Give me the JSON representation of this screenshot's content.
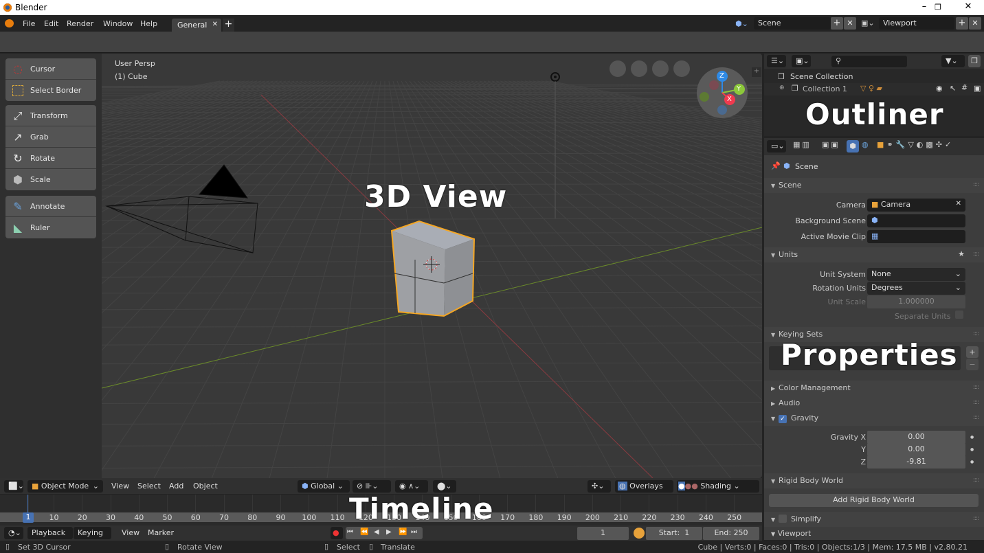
{
  "window": {
    "title": "Blender",
    "controls": [
      "–",
      "❐",
      "✕"
    ]
  },
  "menubar": {
    "items": [
      "File",
      "Edit",
      "Render",
      "Window",
      "Help"
    ],
    "workspace_tab": "General",
    "close": "✕",
    "add": "+",
    "scene": {
      "value": "Scene",
      "add": "+",
      "remove": "✕"
    },
    "view_layer": {
      "value": "Viewport",
      "add": "+",
      "remove": "✕"
    }
  },
  "toolbar": {
    "groups": [
      [
        {
          "label": "Cursor",
          "icon": "cursor-icon"
        },
        {
          "label": "Select Border",
          "icon": "select-border-icon"
        }
      ],
      [
        {
          "label": "Transform",
          "icon": "transform-icon"
        },
        {
          "label": "Grab",
          "icon": "grab-icon"
        },
        {
          "label": "Rotate",
          "icon": "rotate-icon"
        },
        {
          "label": "Scale",
          "icon": "scale-icon"
        }
      ],
      [
        {
          "label": "Annotate",
          "icon": "annotate-icon"
        },
        {
          "label": "Ruler",
          "icon": "ruler-icon"
        }
      ]
    ]
  },
  "viewport": {
    "view_name": "User Persp",
    "object_info": "(1) Cube",
    "overlay_label": "3D View",
    "gizmo": {
      "x": "X",
      "y": "Y",
      "z": "Z",
      "colors": {
        "x": "#f03a4f",
        "y": "#8cc83a",
        "z": "#2e8ae6"
      }
    },
    "selection_color": "#f5a623"
  },
  "viewport_header": {
    "mode": "Object Mode",
    "menus": [
      "View",
      "Select",
      "Add",
      "Object"
    ],
    "orientation": "Global",
    "overlays": "Overlays",
    "shading": "Shading"
  },
  "timeline": {
    "overlay_label": "Timeline",
    "ticks": [
      "1",
      "10",
      "20",
      "30",
      "40",
      "50",
      "60",
      "70",
      "80",
      "90",
      "100",
      "110",
      "120",
      "130",
      "140",
      "150",
      "160",
      "170",
      "180",
      "190",
      "200",
      "210",
      "220",
      "230",
      "240",
      "250"
    ],
    "current_frame": "1",
    "menus": [
      "Playback",
      "Keying",
      "View",
      "Marker"
    ],
    "frame": "1",
    "start_label": "Start:",
    "start": "1",
    "end_label": "End:",
    "end": "250",
    "transport": [
      "⏮",
      "⏪",
      "◀",
      "▶",
      "⏩",
      "⏭"
    ],
    "accent": "#4772b3"
  },
  "status": {
    "hints": [
      "Set 3D Cursor",
      "Rotate View",
      "Select",
      "Translate"
    ],
    "stats": "Cube | Verts:0 | Faces:0 | Tris:0 | Objects:1/3 | Mem: 17.5 MB | v2.80.21"
  },
  "outliner": {
    "overlay_label": "Outliner",
    "search_placeholder": "",
    "root": "Scene Collection",
    "collection": "Collection 1"
  },
  "properties": {
    "overlay_label": "Properties",
    "context": "Scene",
    "scene_panel": {
      "title": "Scene",
      "camera_label": "Camera",
      "camera": "Camera",
      "background_label": "Background Scene",
      "movie_clip_label": "Active Movie Clip"
    },
    "units_panel": {
      "title": "Units",
      "unit_system_label": "Unit System",
      "unit_system": "None",
      "rotation_label": "Rotation Units",
      "rotation": "Degrees",
      "scale_label": "Unit Scale",
      "scale": "1.000000",
      "separate_label": "Separate Units",
      "separate": false
    },
    "keying_sets": {
      "title": "Keying Sets",
      "add": "+",
      "remove": "−"
    },
    "color_management": {
      "title": "Color Management"
    },
    "audio": {
      "title": "Audio"
    },
    "gravity": {
      "title": "Gravity",
      "enabled": true,
      "x_label": "Gravity X",
      "x": "0.00",
      "y_label": "Y",
      "y": "0.00",
      "z_label": "Z",
      "z": "-9.81"
    },
    "rigid_body": {
      "title": "Rigid Body World",
      "button": "Add Rigid Body World"
    },
    "simplify": {
      "title": "Simplify",
      "enabled": false
    },
    "viewport_sub": {
      "title": "Viewport"
    }
  }
}
